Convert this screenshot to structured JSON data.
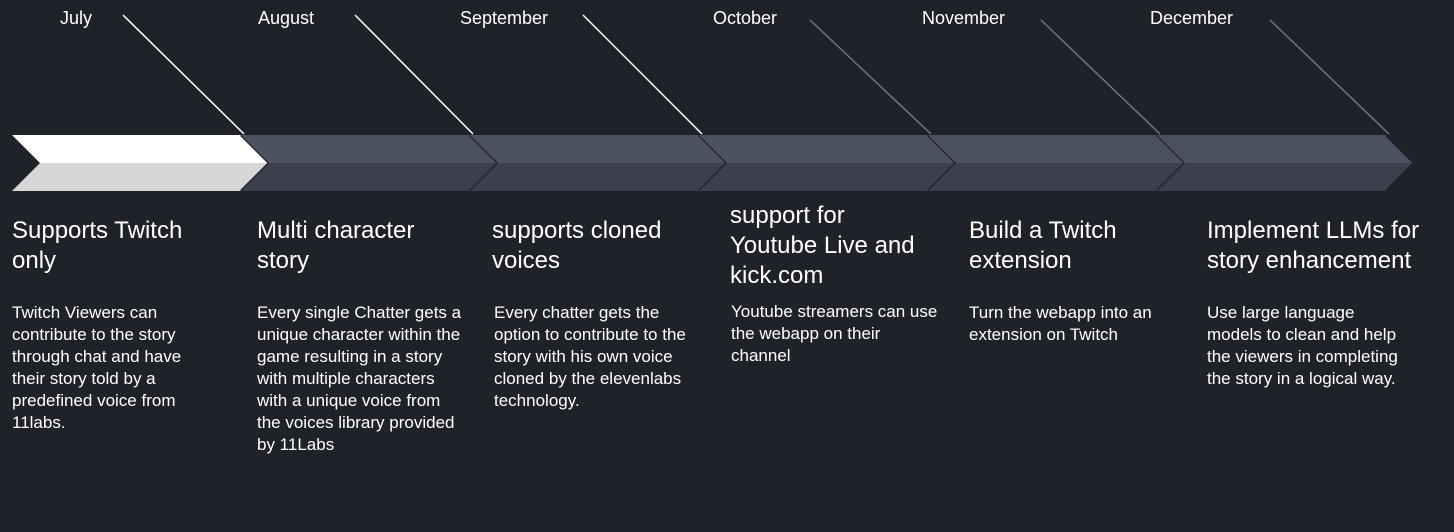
{
  "timeline": {
    "months": [
      "July",
      "August",
      "September",
      "October",
      "November",
      "December"
    ],
    "phases": [
      {
        "title": "Supports Twitch only",
        "description": "Twitch Viewers can contribute to the story through chat and have their story told by a predefined voice from 11labs."
      },
      {
        "title": "Multi character story",
        "description": "Every single Chatter gets a unique character within the game resulting in a story with multiple characters with a unique voice from the voices library provided by 11Labs"
      },
      {
        "title": "supports cloned voices",
        "description": "Every chatter gets the option to contribute to the story with his own voice cloned by the elevenlabs technology."
      },
      {
        "title": "support for Youtube Live and kick.com",
        "description": "Youtube streamers can use the webapp on their channel"
      },
      {
        "title": "Build a Twitch extension",
        "description": "Turn the webapp into an extension on Twitch"
      },
      {
        "title": "Implement LLMs for story enhancement",
        "description": "Use large language models to clean and help the viewers in completing the story in a logical way."
      }
    ],
    "completed_phases": 3,
    "colors": {
      "background": "#1f2329",
      "active_chevron_top": "#ffffff",
      "active_chevron_bottom": "#d6d6d6",
      "inactive_chevron_top": "#4b5160",
      "inactive_chevron_bottom": "#3b404c",
      "connector_active": "#ffffff",
      "connector_inactive": "#6f7581",
      "text": "#ffffff"
    }
  }
}
